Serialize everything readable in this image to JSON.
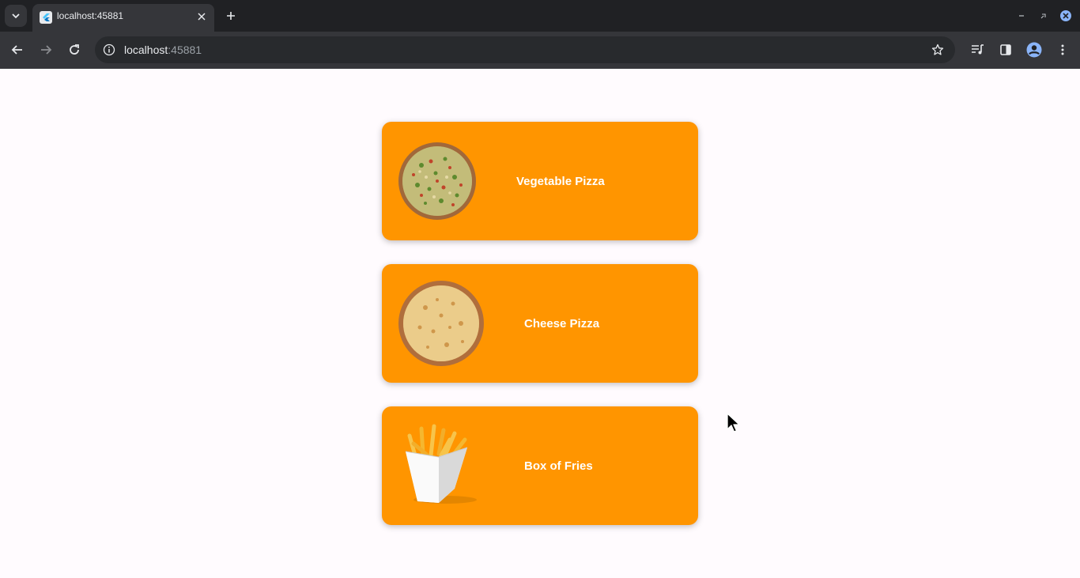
{
  "browser": {
    "tab_title": "localhost:45881",
    "url_host": "localhost",
    "url_port": ":45881"
  },
  "menu": {
    "items": [
      {
        "label": "Vegetable Pizza",
        "image": "vegetable-pizza-image"
      },
      {
        "label": "Cheese Pizza",
        "image": "cheese-pizza-image"
      },
      {
        "label": "Box of Fries",
        "image": "fries-image"
      }
    ]
  },
  "colors": {
    "card": "#ff9500",
    "page_background": "#fffbfe",
    "card_text": "#ffffff"
  }
}
